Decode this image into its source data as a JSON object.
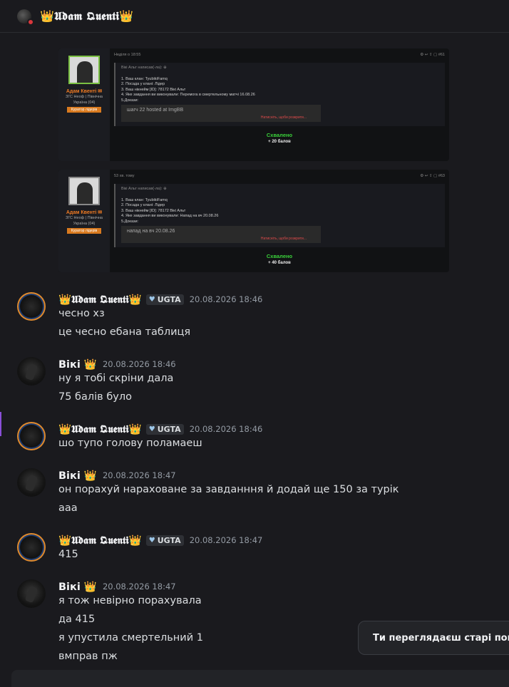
{
  "header": {
    "title": "👑𝖀𝖉𝖆𝖒 𝕼𝖚𝖊𝖓𝖙𝖎👑"
  },
  "embeds": [
    {
      "user": "Адам Квенті ✉",
      "info": [
        "ЗГС Неоф | Північна",
        "Україна (04)"
      ],
      "badge": "Куратор лідерів",
      "meta_left": "Неділя о 18:55",
      "meta_right": "⚙ ↩ ⇪ ▢ #61",
      "quote_head": "Вікі Альт написав(-ла): ⊕",
      "lines": [
        "1. Ваш клан: TyubikiFamq",
        "2. Посада у клані: Лідер",
        "3. Ваш нікнейм [ID]: 78172 Вікі Альт",
        "4. Яке завдання ви виконували: Перемога в смертельному матчі 16.08.26",
        "5.Докази:"
      ],
      "media": "шагч 22 hosted at ImgBB",
      "media_note": "Натисніть, щоби розкрити...",
      "status": "Схвалено",
      "points": "+ 20 балов"
    },
    {
      "user": "Адам Квенті ✉",
      "info": [
        "ЗГС Неоф | Північна",
        "Україна (04)"
      ],
      "badge": "Куратор лідерів",
      "meta_left": "53 хв. тому",
      "meta_right": "⚙ ↩ ⇪ ▢ #63",
      "quote_head": "Вікі Альт написав(-ла): ⊕",
      "lines": [
        "1. Ваш клан: TyubikiFamq",
        "2. Посада у клані: Лідер",
        "3. Ваш нікнейм [ID]: 78172 Вікі Альт",
        "4. Яке завдання ви виконували: Напад на вч 20.08.26",
        "5.Докази:"
      ],
      "media": "напад на вч 20.08.26",
      "media_note": "Натисніть, щоби розкрити...",
      "status": "Схвалено",
      "points": "+ 40 балов"
    }
  ],
  "messages": [
    {
      "author": "👑𝖀𝖉𝖆𝖒 𝕼𝖚𝖊𝖓𝖙𝖎👑",
      "tag": "UGTA",
      "time": "20.08.2026 18:46",
      "lines": [
        "чесно хз",
        "це чесно ебана таблиця"
      ]
    },
    {
      "author": "Вікі 👑",
      "time": "20.08.2026 18:46",
      "lines": [
        "ну я тобі скріни дала",
        "75 балів було"
      ]
    },
    {
      "author": "👑𝖀𝖉𝖆𝖒 𝕼𝖚𝖊𝖓𝖙𝖎👑",
      "tag": "UGTA",
      "time": "20.08.2026 18:46",
      "lines": [
        "шо тупо голову поламаеш"
      ]
    },
    {
      "author": "Вікі 👑",
      "time": "20.08.2026 18:47",
      "lines": [
        "он порахуй нараховане за завданння й додай ще 150 за турік",
        "ааа"
      ]
    },
    {
      "author": "👑𝖀𝖉𝖆𝖒 𝕼𝖚𝖊𝖓𝖙𝖎👑",
      "tag": "UGTA",
      "time": "20.08.2026 18:47",
      "lines": [
        "415"
      ]
    },
    {
      "author": "Вікі 👑",
      "time": "20.08.2026 18:47",
      "lines": [
        "я тож невірно порахувала",
        "да 415",
        "я упустила смертельний 1",
        "вмправ пж"
      ]
    }
  ],
  "toast": {
    "text": "Ти переглядаєш старі повідомлення"
  }
}
